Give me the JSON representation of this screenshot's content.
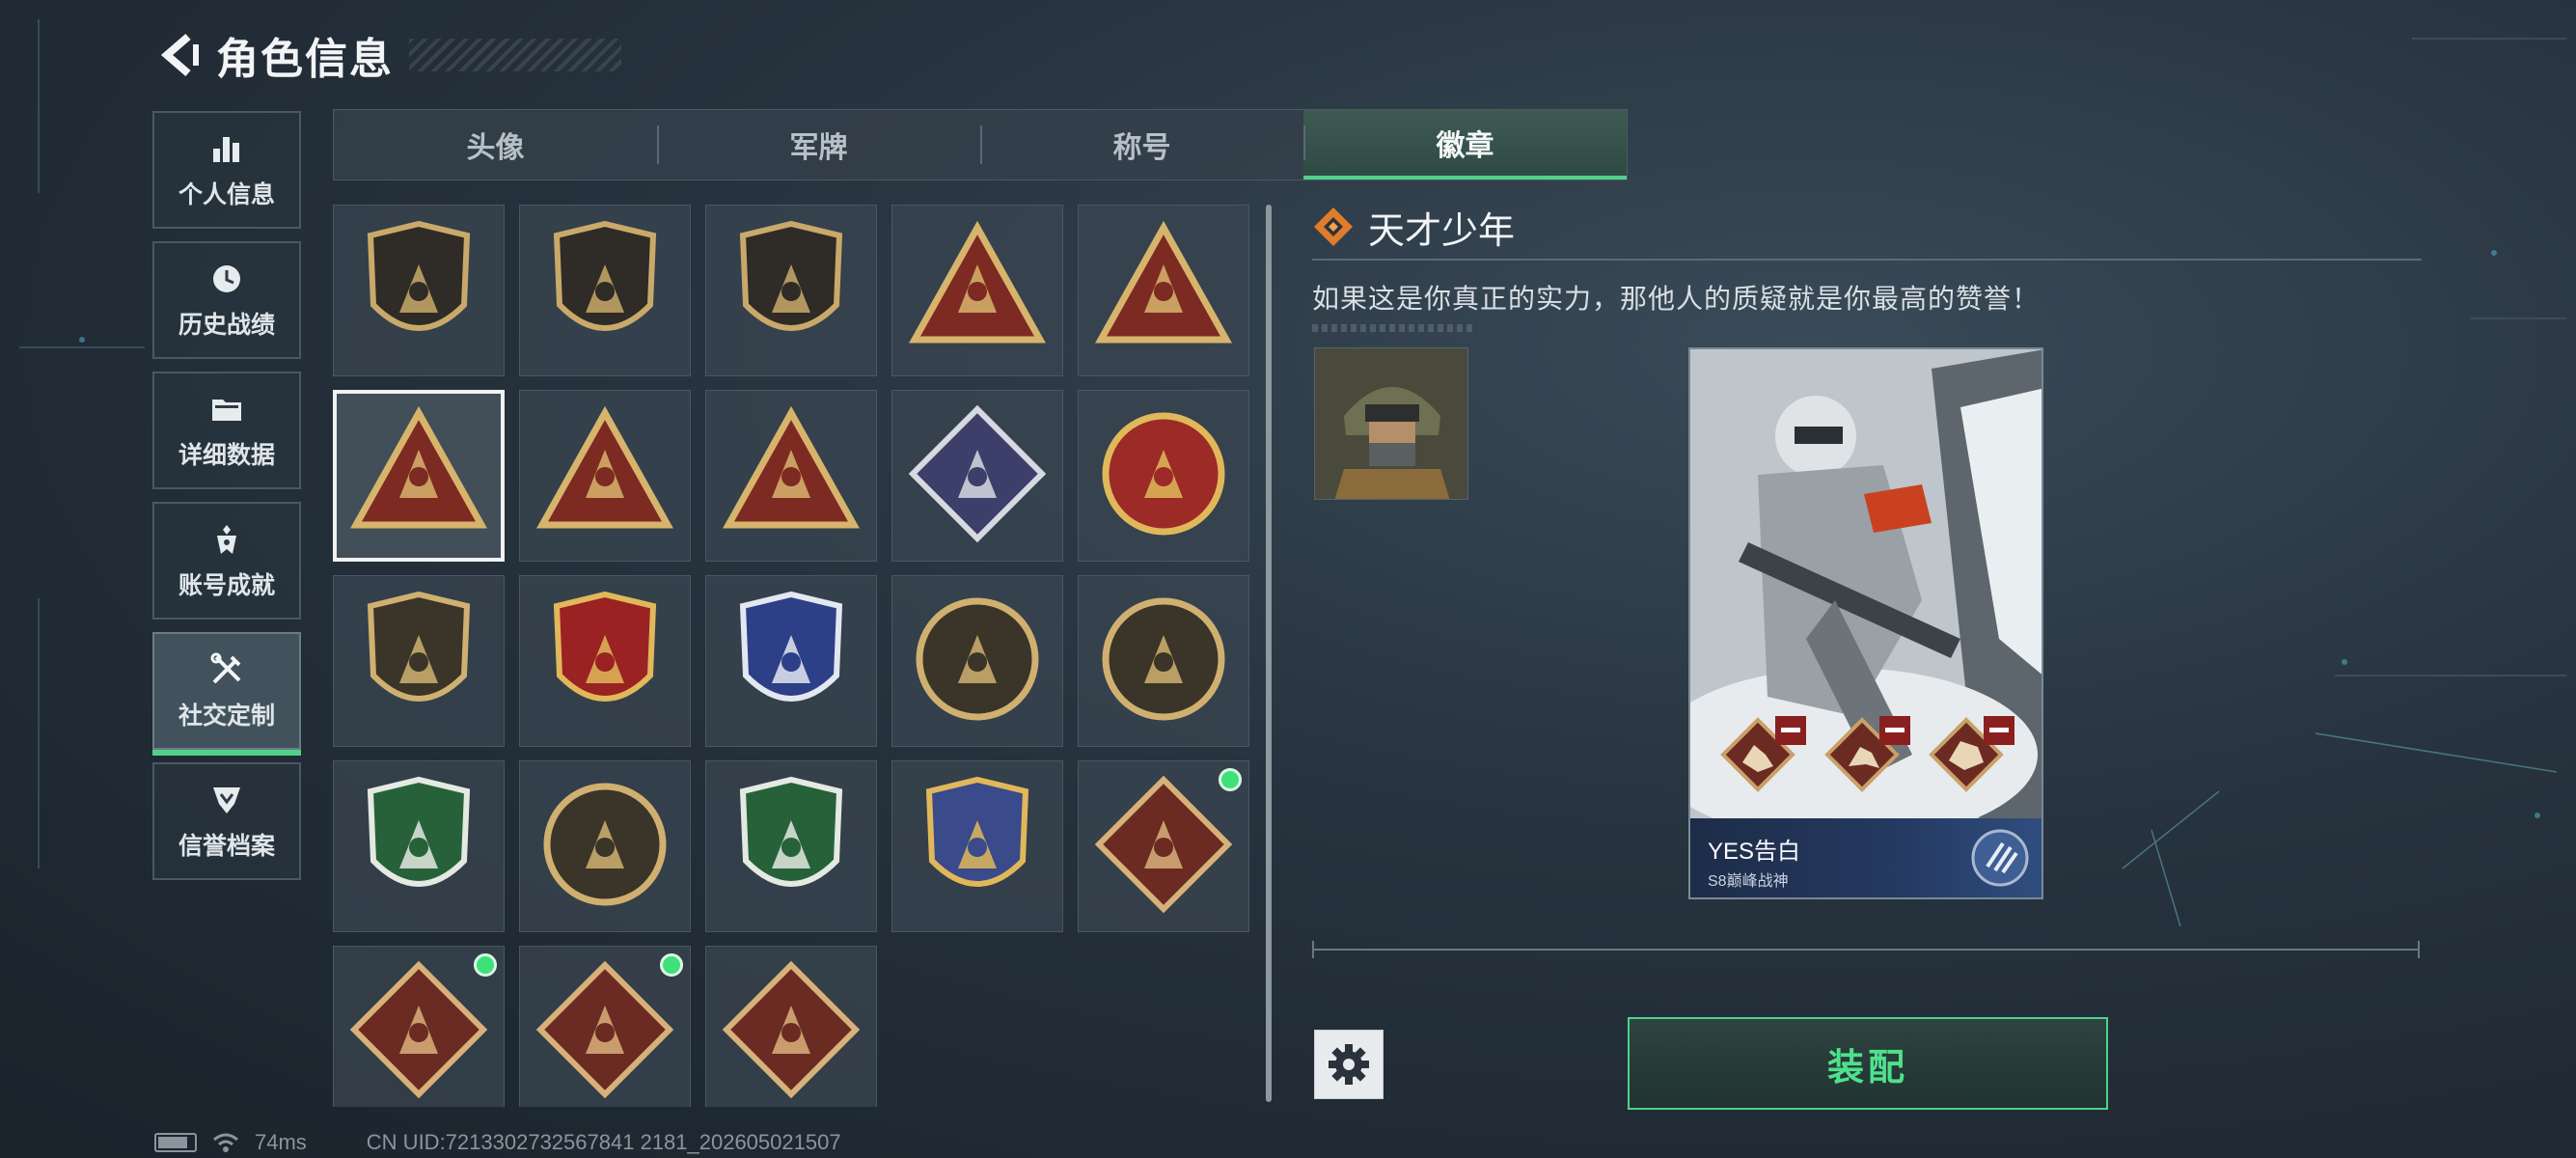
{
  "header": {
    "title": "角色信息"
  },
  "sidebar": {
    "items": [
      {
        "label": "个人信息",
        "icon": "bar-chart-icon"
      },
      {
        "label": "历史战绩",
        "icon": "clock-icon"
      },
      {
        "label": "详细数据",
        "icon": "folder-icon"
      },
      {
        "label": "账号成就",
        "icon": "achievement-icon"
      },
      {
        "label": "社交定制",
        "icon": "tools-icon",
        "active": true
      },
      {
        "label": "信誉档案",
        "icon": "shield-chevron-icon"
      }
    ]
  },
  "tabs": [
    {
      "label": "头像"
    },
    {
      "label": "军牌"
    },
    {
      "label": "称号"
    },
    {
      "label": "徽章",
      "active": true
    }
  ],
  "badges": [
    {
      "icon": "shield-triangle-badge-icon",
      "new": false
    },
    {
      "icon": "helicopter-badge-icon",
      "new": false
    },
    {
      "icon": "dagger-shield-badge-icon",
      "new": false
    },
    {
      "icon": "s8-vehicle-triangle-badge-icon",
      "new": false
    },
    {
      "icon": "ship-triangle-badge-icon",
      "new": false
    },
    {
      "icon": "tower-triangle-badge-icon",
      "new": false,
      "selected": true
    },
    {
      "icon": "soldiers-triangle-badge-icon",
      "new": false
    },
    {
      "icon": "rocket-triangle-badge-icon",
      "new": false
    },
    {
      "icon": "rose-diamond-badge-icon",
      "new": false
    },
    {
      "icon": "star-skull-round-badge-icon",
      "new": false
    },
    {
      "icon": "emblem-shield-badge-icon",
      "new": false
    },
    {
      "icon": "winged-star-shield-badge-icon",
      "new": false
    },
    {
      "icon": "crystal-blue-shield-badge-icon",
      "new": false
    },
    {
      "icon": "crosshair-round-badge-icon",
      "new": false
    },
    {
      "icon": "tank-sunburst-badge-icon",
      "new": false
    },
    {
      "icon": "rifle-green-shield-badge-icon",
      "new": false
    },
    {
      "icon": "smg-round-badge-icon",
      "new": false
    },
    {
      "icon": "rifle-green-shield-2-badge-icon",
      "new": false
    },
    {
      "icon": "crossed-weapons-shield-badge-icon",
      "new": false
    },
    {
      "icon": "wolf-diamond-badge-icon",
      "new": true
    },
    {
      "icon": "dragon-diamond-badge-icon",
      "new": true
    },
    {
      "icon": "runner-diamond-badge-icon",
      "new": true
    },
    {
      "icon": "tool-diamond-badge-icon",
      "new": false
    }
  ],
  "detail": {
    "name": "天才少年",
    "description": "如果这是你真正的实力，那他人的质疑就是你最高的赞誉！",
    "card": {
      "player_name": "YES告白",
      "subtitle": "S8巅峰战神"
    }
  },
  "actions": {
    "equip_label": "装配"
  },
  "status_bar": {
    "latency": "74ms",
    "uid": "CN UID:7213302732567841 2181_202605021507"
  },
  "colors": {
    "accent": "#4fd18a",
    "new_dot": "#3ee07a",
    "card_footer": "#253a62"
  }
}
